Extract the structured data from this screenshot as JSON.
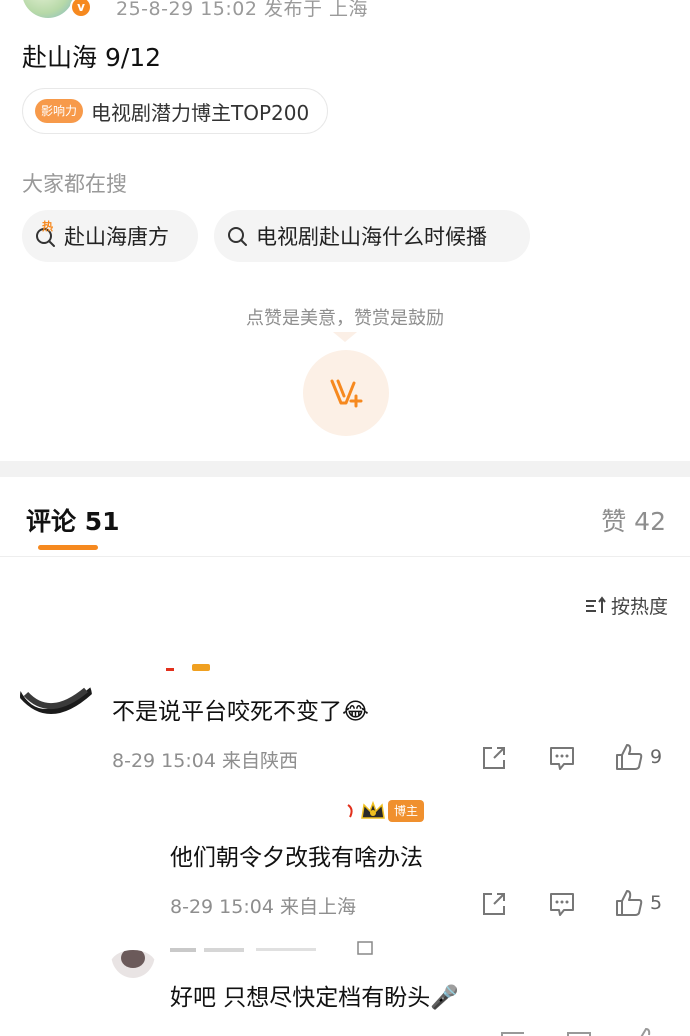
{
  "post": {
    "meta": "25-8-29 15:02  发布于 上海",
    "verify_mark": "v",
    "text": "赴山海 9/12",
    "influence_tag": "影响力",
    "influence_label": "电视剧潜力博主TOP200"
  },
  "search": {
    "heading": "大家都在搜",
    "hot_mark": "热",
    "items": [
      {
        "label": "赴山海唐方",
        "icon": "hot-search-icon"
      },
      {
        "label": "电视剧赴山海什么时候播",
        "icon": "search-icon"
      }
    ]
  },
  "reward": {
    "text": "点赞是美意，赞赏是鼓励",
    "icon": "reward-v-plus-icon"
  },
  "tabs": {
    "comments_label": "评论 51",
    "likes_label": "赞 42"
  },
  "sort": {
    "label": "按热度",
    "icon": "sort-icon"
  },
  "colors": {
    "accent": "#f6891f",
    "muted": "#8e8e8e",
    "divider": "#f2f2f2"
  },
  "comments": [
    {
      "text": "不是说平台咬死不变了😂",
      "meta": "8-29 15:04  来自陕西",
      "likes": "9"
    },
    {
      "role_badge": "博主",
      "text": "他们朝令夕改我有啥办法",
      "meta": "8-29 15:04  来自上海",
      "likes": "5"
    },
    {
      "text": "好吧  只想尽快定档有盼头🎤"
    }
  ]
}
